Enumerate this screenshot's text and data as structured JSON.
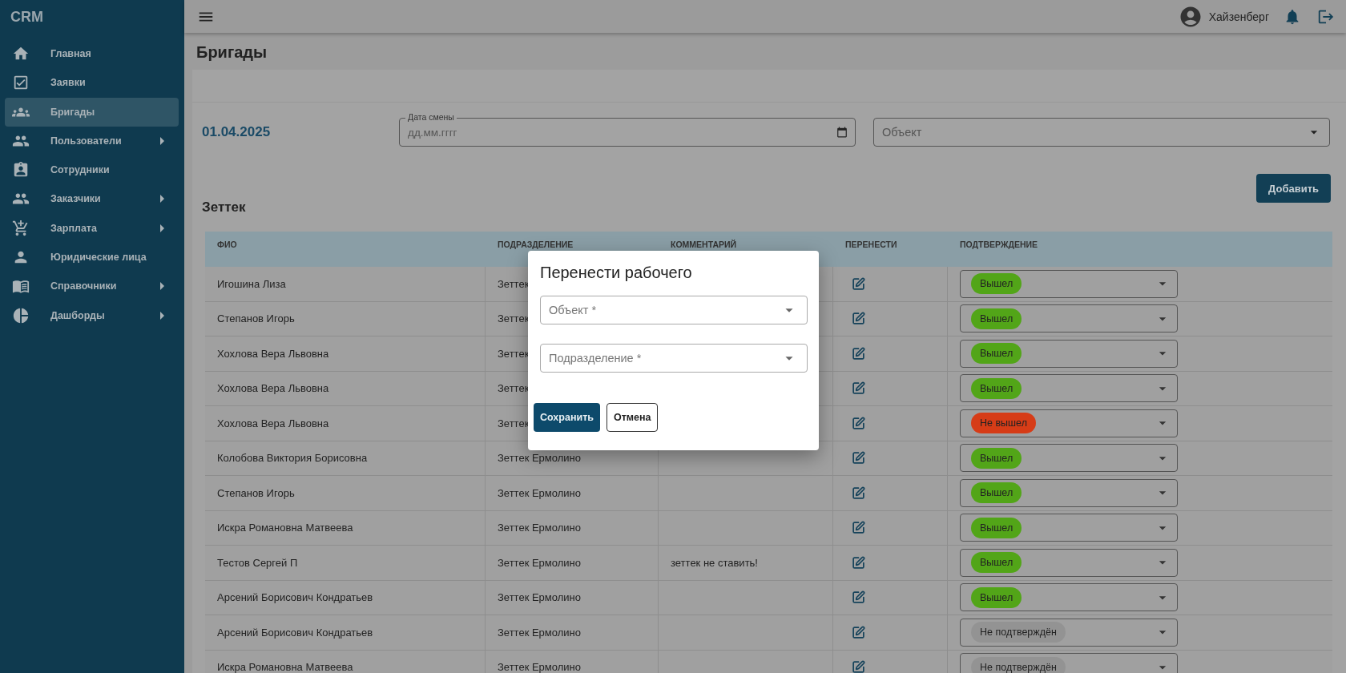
{
  "sidebar": {
    "logo": "CRM",
    "items": [
      {
        "label": "Главная",
        "kind": "home",
        "selected": false,
        "expandable": false
      },
      {
        "label": "Заявки",
        "kind": "checkbox",
        "selected": false,
        "expandable": false
      },
      {
        "label": "Бригады",
        "kind": "groups",
        "selected": true,
        "expandable": false
      },
      {
        "label": "Пользователи",
        "kind": "people",
        "selected": false,
        "expandable": true
      },
      {
        "label": "Сотрудники",
        "kind": "badge",
        "selected": false,
        "expandable": false
      },
      {
        "label": "Заказчики",
        "kind": "people",
        "selected": false,
        "expandable": true
      },
      {
        "label": "Зарплата",
        "kind": "cart",
        "selected": false,
        "expandable": true
      },
      {
        "label": "Юридические лица",
        "kind": "person",
        "selected": false,
        "expandable": false
      },
      {
        "label": "Справочники",
        "kind": "book",
        "selected": false,
        "expandable": true
      },
      {
        "label": "Дашборды",
        "kind": "pie",
        "selected": false,
        "expandable": true
      }
    ]
  },
  "topbar": {
    "user": "Хайзенберг"
  },
  "page": {
    "title": "Бригады"
  },
  "filters": {
    "current_date": "01.04.2025",
    "date_field": {
      "label": "Дата смены",
      "placeholder": "дд.мм.гггг"
    },
    "object_field": {
      "placeholder": "Объект"
    }
  },
  "add_button": "Добавить",
  "group": {
    "title": "Зеттек",
    "columns": [
      "ФИО",
      "ПОДРАЗДЕЛЕНИЕ",
      "КОММЕНТАРИЙ",
      "ПЕРЕНЕСТИ",
      "ПОДТВЕРЖДЕНИЕ"
    ],
    "rows": [
      {
        "name": "Игошина Лиза",
        "department": "Зеттек",
        "status": {
          "label": "Вышел",
          "color": "#52a518"
        }
      },
      {
        "name": "Степанов Игорь",
        "department": "Зеттек",
        "status": {
          "label": "Вышел",
          "color": "#52a518"
        }
      },
      {
        "name": "Хохлова Вера Львовна",
        "department": "Зеттек",
        "status": {
          "label": "Вышел",
          "color": "#52a518"
        }
      },
      {
        "name": "Хохлова Вера Львовна",
        "department": "Зеттек",
        "status": {
          "label": "Вышел",
          "color": "#52a518"
        }
      },
      {
        "name": "Хохлова Вера Львовна",
        "department": "Зеттек",
        "status": {
          "label": "Не вышел",
          "color": "#d63c17"
        }
      },
      {
        "name": "Колобова Виктория Борисовна",
        "department": "Зеттек Ермолино",
        "status": {
          "label": "Вышел",
          "color": "#52a518"
        }
      },
      {
        "name": "Степанов Игорь",
        "department": "Зеттек Ермолино",
        "status": {
          "label": "Вышел",
          "color": "#52a518"
        }
      },
      {
        "name": "Искра Романовна Матвеева",
        "department": "Зеттек Ермолино",
        "status": {
          "label": "Вышел",
          "color": "#52a518"
        }
      },
      {
        "name": "Тестов Сергей П",
        "department": "Зеттек Ермолино",
        "comment": "зеттек не ставить!",
        "status": {
          "label": "Вышел",
          "color": "#52a518"
        }
      },
      {
        "name": "Арсений Борисович Кондратьев",
        "department": "Зеттек Ермолино",
        "status": {
          "label": "Вышел",
          "color": "#52a518"
        }
      },
      {
        "name": "Арсений Борисович Кондратьев",
        "department": "Зеттек Ермолино",
        "status": {
          "label": "Не подтверждён",
          "color": "#939393"
        }
      },
      {
        "name": "Искра Романовна Матвеева",
        "department": "Зеттек Ермолино",
        "status": {
          "label": "Не подтверждён",
          "color": "#939393"
        }
      }
    ]
  },
  "dialog": {
    "title": "Перенести рабочего",
    "fields": [
      {
        "placeholder": "Объект *"
      },
      {
        "placeholder": "Подразделение *"
      }
    ],
    "save": "Сохранить",
    "cancel": "Отмена"
  }
}
